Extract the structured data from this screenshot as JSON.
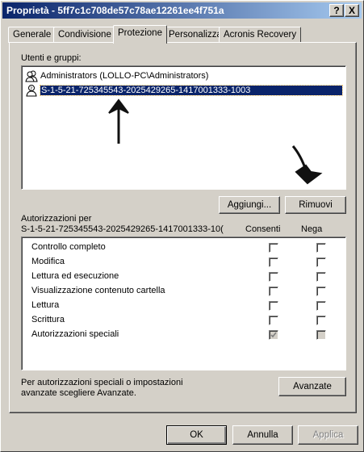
{
  "window": {
    "title": "Proprietà - 5ff7c1c708de57c78ae12261ee4f751a",
    "help_button": "?",
    "close_button": "X"
  },
  "tabs": [
    {
      "label": "Generale",
      "active": false
    },
    {
      "label": "Condivisione",
      "active": false
    },
    {
      "label": "Protezione",
      "active": true
    },
    {
      "label": "Personalizza",
      "active": false
    },
    {
      "label": "Acronis Recovery",
      "active": false
    }
  ],
  "users": {
    "label": "Utenti e gruppi:",
    "items": [
      {
        "name": "Administrators (LOLLO-PC\\Administrators)",
        "icon": "group-icon",
        "selected": false
      },
      {
        "name": "S-1-5-21-725345543-2025429265-1417001333-1003",
        "icon": "unknown-user-icon",
        "selected": true
      }
    ],
    "add_button": "Aggiungi...",
    "remove_button": "Rimuovi"
  },
  "permissions": {
    "label_line1": "Autorizzazioni per",
    "label_line2": "S-1-5-21-725345543-2025429265-1417001333-10(",
    "allow_header": "Consenti",
    "deny_header": "Nega",
    "rows": [
      {
        "name": "Controllo completo",
        "allow": false,
        "deny": false,
        "grayed": false
      },
      {
        "name": "Modifica",
        "allow": false,
        "deny": false,
        "grayed": false
      },
      {
        "name": "Lettura ed esecuzione",
        "allow": false,
        "deny": false,
        "grayed": false
      },
      {
        "name": "Visualizzazione contenuto cartella",
        "allow": false,
        "deny": false,
        "grayed": false
      },
      {
        "name": "Lettura",
        "allow": false,
        "deny": false,
        "grayed": false
      },
      {
        "name": "Scrittura",
        "allow": false,
        "deny": false,
        "grayed": false
      },
      {
        "name": "Autorizzazioni speciali",
        "allow": true,
        "deny": false,
        "grayed": true
      }
    ]
  },
  "advanced": {
    "text_line1": "Per autorizzazioni speciali o impostazioni",
    "text_line2": "avanzate scegliere Avanzate.",
    "button": "Avanzate"
  },
  "footer": {
    "ok": "OK",
    "cancel": "Annulla",
    "apply": "Applica"
  },
  "colors": {
    "face": "#d4d0c8",
    "title_start": "#0a246a",
    "title_end": "#a6caf0",
    "selection": "#0a246a"
  }
}
